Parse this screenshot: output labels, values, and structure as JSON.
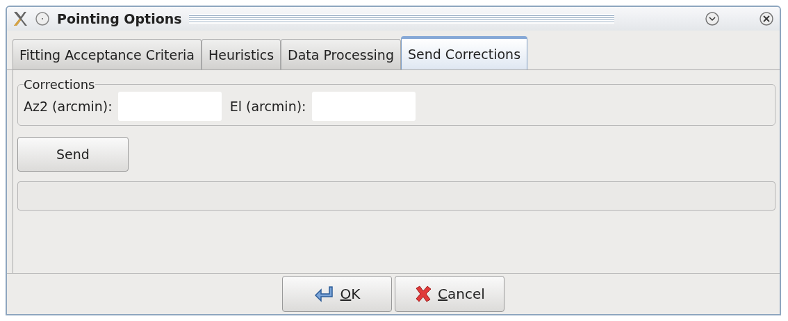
{
  "window": {
    "title": "Pointing Options"
  },
  "tabs": [
    {
      "label": "Fitting Acceptance Criteria",
      "selected": false
    },
    {
      "label": "Heuristics",
      "selected": false
    },
    {
      "label": "Data Processing",
      "selected": false
    },
    {
      "label": "Send Corrections",
      "selected": true
    }
  ],
  "corrections": {
    "title": "Corrections",
    "fields": [
      {
        "label": "Az2 (arcmin):"
      },
      {
        "label": "El (arcmin):"
      }
    ]
  },
  "send_button": "Send",
  "buttons": [
    {
      "label": "OK",
      "kind": "ok",
      "underline_first": true
    },
    {
      "label": "Cancel",
      "kind": "cancel",
      "underline_first": true
    }
  ]
}
